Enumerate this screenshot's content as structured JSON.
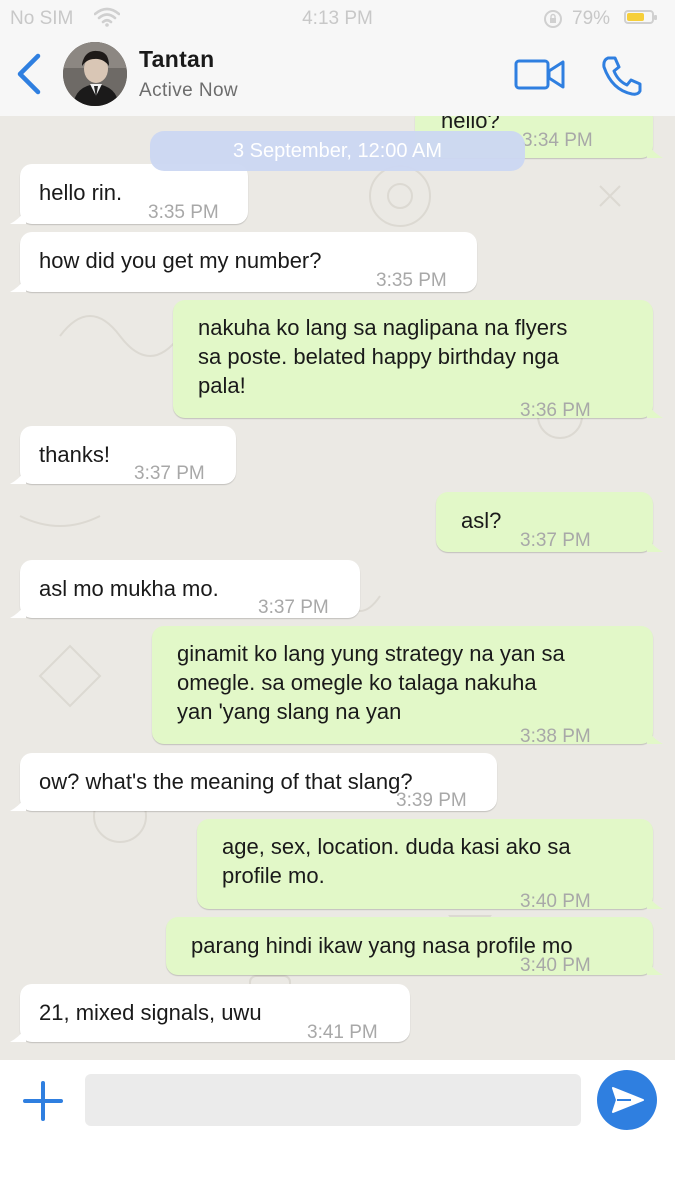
{
  "status_bar": {
    "carrier": "No SIM",
    "time": "4:13 PM",
    "battery_percent": "79%",
    "battery_level": 0.79
  },
  "header": {
    "contact_name": "Tantan",
    "contact_status": "Active Now"
  },
  "date_chip": "3 September, 12:00 AM",
  "messages": [
    {
      "direction": "out",
      "text": "hello?",
      "time": "3:34 PM"
    },
    {
      "direction": "in",
      "text": "hello rin.",
      "time": "3:35 PM"
    },
    {
      "direction": "in",
      "text": "how did you get my number?",
      "time": "3:35 PM"
    },
    {
      "direction": "out",
      "lines": [
        "nakuha ko lang sa naglipana na flyers",
        "sa poste. belated happy birthday nga",
        "pala!"
      ],
      "time": "3:36 PM"
    },
    {
      "direction": "in",
      "text": "thanks!",
      "time": "3:37 PM"
    },
    {
      "direction": "out",
      "text": "asl?",
      "time": "3:37 PM"
    },
    {
      "direction": "in",
      "text": "asl mo mukha mo.",
      "time": "3:37 PM"
    },
    {
      "direction": "out",
      "lines": [
        "ginamit ko lang yung strategy na yan sa",
        "omegle. sa omegle ko talaga nakuha",
        "yan 'yang slang na yan"
      ],
      "time": "3:38 PM"
    },
    {
      "direction": "in",
      "text": "ow? what's the meaning of that slang?",
      "time": "3:39 PM"
    },
    {
      "direction": "out",
      "lines": [
        "age, sex, location. duda kasi ako sa",
        "profile mo."
      ],
      "time": "3:40 PM"
    },
    {
      "direction": "out",
      "text": "parang hindi ikaw yang nasa profile mo",
      "time": "3:40 PM"
    },
    {
      "direction": "in",
      "text": "21, mixed signals, uwu",
      "time": "3:41 PM"
    }
  ],
  "composer": {
    "placeholder": ""
  },
  "colors": {
    "accent": "#2f7fe0",
    "outgoing_bubble": "#e2f8c8",
    "incoming_bubble": "#ffffff",
    "chat_background": "#ebe9e4",
    "battery_fill": "#f6cf3a"
  },
  "icons": {
    "back": "chevron-left-icon",
    "video": "video-camera-icon",
    "call": "phone-icon",
    "add": "plus-icon",
    "send": "send-arrow-icon"
  }
}
